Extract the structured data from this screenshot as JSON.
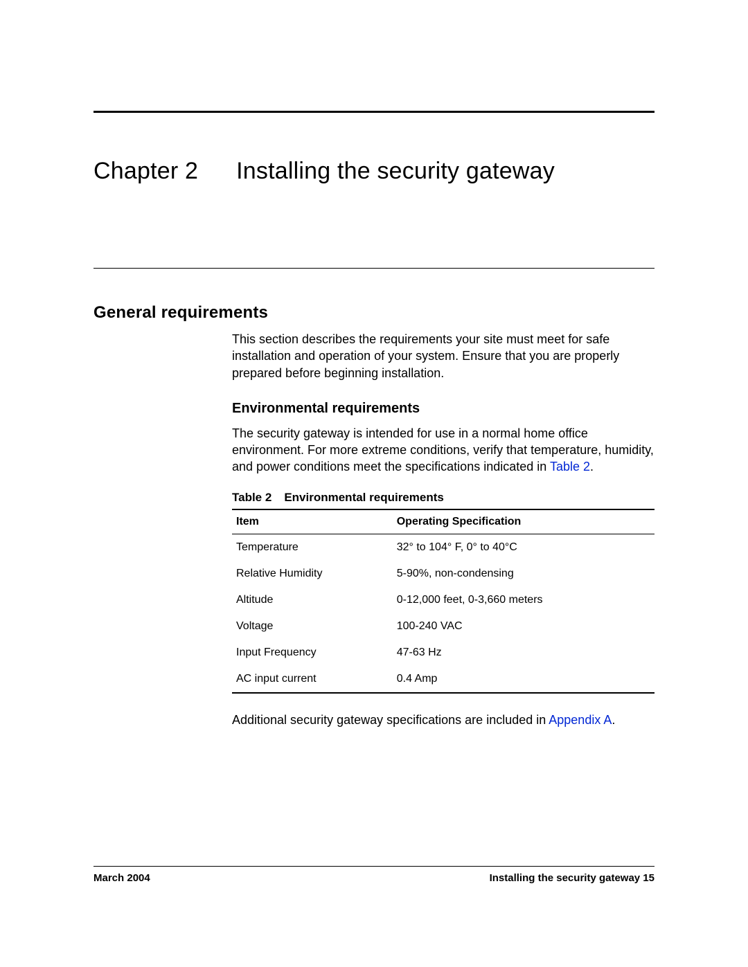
{
  "chapter": {
    "label": "Chapter 2",
    "title": "Installing the security gateway"
  },
  "section": {
    "heading": "General requirements",
    "intro": "This section describes the requirements your site must meet for safe installation and operation of your system. Ensure that you are properly prepared before beginning installation."
  },
  "subsection": {
    "heading": "Environmental requirements",
    "para_before_link": "The security gateway is intended for use in a normal home office environment. For more extreme conditions, verify that temperature, humidity, and power conditions meet the specifications indicated in ",
    "link_text": "Table 2",
    "para_after_link": "."
  },
  "table": {
    "caption_label": "Table 2",
    "caption_title": "Environmental requirements",
    "headers": {
      "col1": "Item",
      "col2": "Operating Specification"
    },
    "rows": [
      {
        "item": "Temperature",
        "spec": "32° to 104° F, 0° to 40°C"
      },
      {
        "item": "Relative Humidity",
        "spec": "5-90%, non-condensing"
      },
      {
        "item": "Altitude",
        "spec": "0-12,000 feet, 0-3,660 meters"
      },
      {
        "item": "Voltage",
        "spec": "100-240 VAC"
      },
      {
        "item": "Input Frequency",
        "spec": "47-63 Hz"
      },
      {
        "item": "AC input current",
        "spec": "0.4 Amp"
      }
    ]
  },
  "closing": {
    "before_link": "Additional security gateway specifications are included in ",
    "link_text": "Appendix A",
    "after_link": "."
  },
  "footer": {
    "left": "March 2004",
    "right": "Installing the security gateway 15"
  }
}
